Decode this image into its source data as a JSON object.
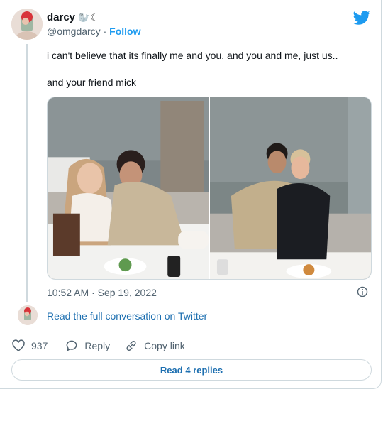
{
  "author": {
    "display_name": "darcy",
    "name_emoji": "🦭☾",
    "handle": "@omgdarcy",
    "separator": "·",
    "follow_label": "Follow"
  },
  "tweet": {
    "line1": "i can't believe that its finally me and you, and you and me, just us..",
    "line2": "and your friend mick",
    "timestamp": "10:52 AM · Sep 19, 2022"
  },
  "conversation_link": "Read the full conversation on Twitter",
  "actions": {
    "like_count": "937",
    "reply_label": "Reply",
    "copy_label": "Copy link"
  },
  "replies_button": "Read 4 replies",
  "colors": {
    "accent": "#1d9bf0",
    "link": "#1d6fb0",
    "muted": "#536471",
    "border": "#cfd9de"
  },
  "icons": [
    "twitter-bird-icon",
    "info-icon",
    "heart-icon",
    "reply-bubble-icon",
    "link-icon"
  ]
}
